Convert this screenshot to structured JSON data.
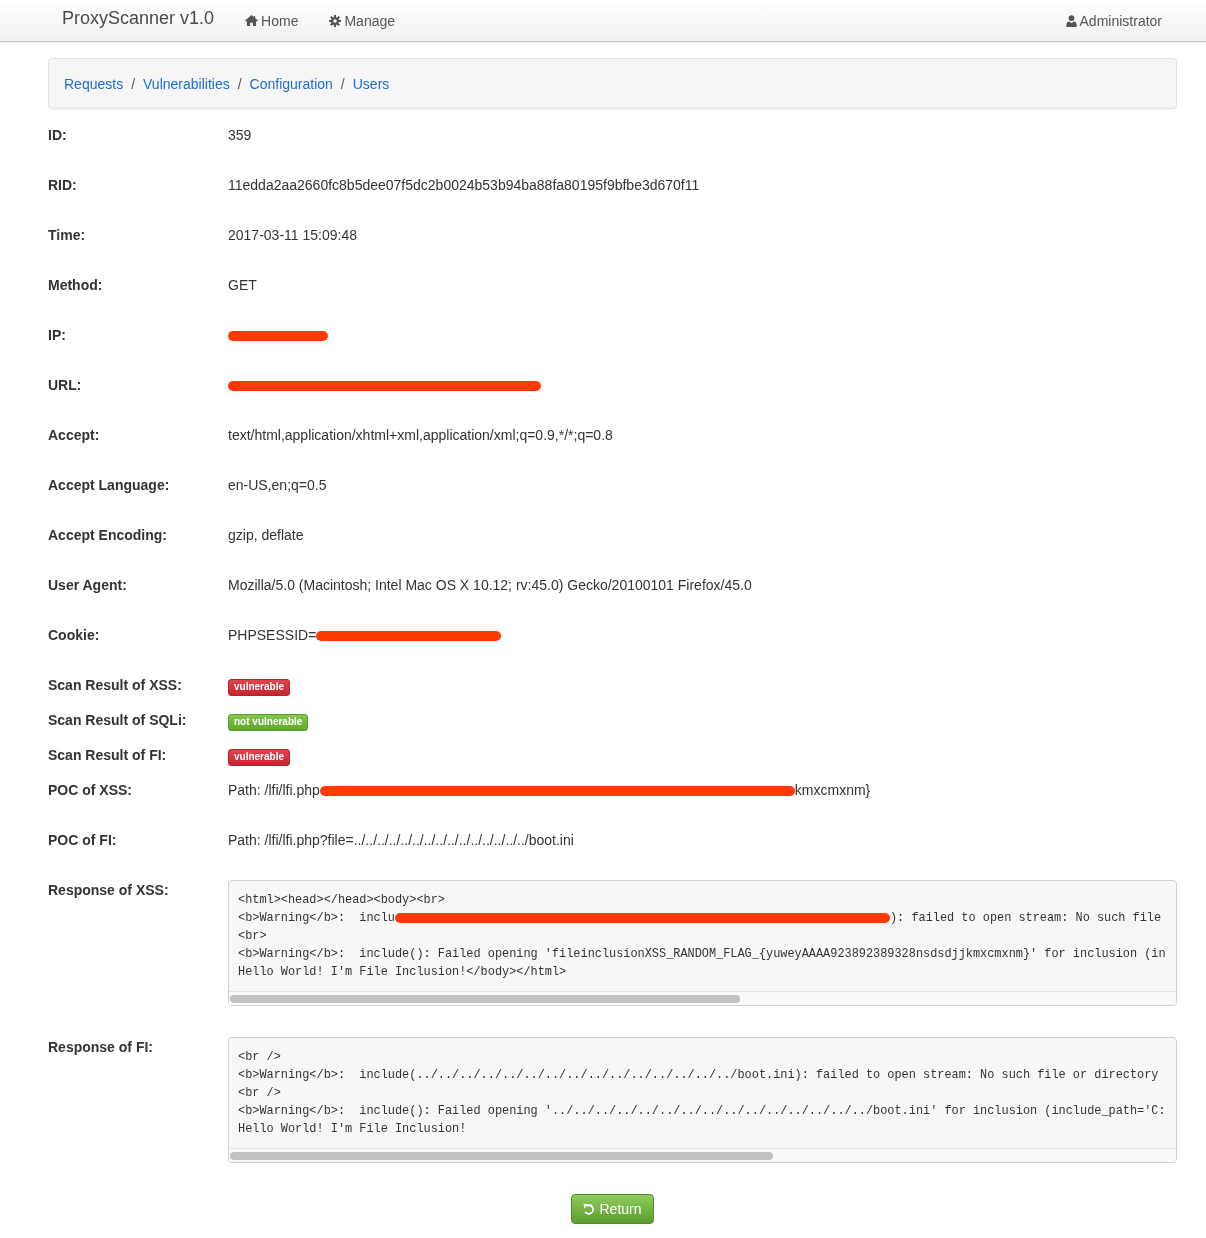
{
  "navbar": {
    "brand": "ProxyScanner v1.0",
    "links": [
      {
        "label": "Home"
      },
      {
        "label": "Manage"
      }
    ],
    "user": "Administrator"
  },
  "breadcrumb": [
    {
      "kind": "link",
      "label": "Requests"
    },
    {
      "kind": "separator",
      "label": "/"
    },
    {
      "kind": "link",
      "label": "Vulnerabilities"
    },
    {
      "kind": "separator",
      "label": "/"
    },
    {
      "kind": "link",
      "label": "Configuration"
    },
    {
      "kind": "separator",
      "label": "/"
    },
    {
      "kind": "link",
      "label": "Users"
    }
  ],
  "details": [
    {
      "label": "ID:",
      "kind": "text",
      "value": [
        {
          "kind": "text",
          "text": "359"
        }
      ]
    },
    {
      "label": "RID:",
      "kind": "text",
      "value": [
        {
          "kind": "text",
          "text": "11edda2aa2660fc8b5dee07f5dc2b0024b53b94ba88fa80195f9bfbe3d670f11"
        }
      ]
    },
    {
      "label": "Time:",
      "kind": "text",
      "value": [
        {
          "kind": "text",
          "text": "2017-03-11 15:09:48"
        }
      ]
    },
    {
      "label": "Method:",
      "kind": "text",
      "value": [
        {
          "kind": "text",
          "text": "GET"
        }
      ]
    },
    {
      "label": "IP:",
      "kind": "text",
      "value": [
        {
          "kind": "redacted"
        }
      ]
    },
    {
      "label": "URL:",
      "kind": "text",
      "value": [
        {
          "kind": "redacted"
        }
      ]
    },
    {
      "label": "Accept:",
      "kind": "text",
      "value": [
        {
          "kind": "text",
          "text": "text/html,application/xhtml+xml,application/xml;q=0.9,*/*;q=0.8"
        }
      ]
    },
    {
      "label": "Accept Language:",
      "kind": "text",
      "value": [
        {
          "kind": "text",
          "text": "en-US,en;q=0.5"
        }
      ]
    },
    {
      "label": "Accept Encoding:",
      "kind": "text",
      "value": [
        {
          "kind": "text",
          "text": "gzip, deflate"
        }
      ]
    },
    {
      "label": "User Agent:",
      "kind": "text",
      "value": [
        {
          "kind": "text",
          "text": "Mozilla/5.0 (Macintosh; Intel Mac OS X 10.12; rv:45.0) Gecko/20100101 Firefox/45.0"
        }
      ]
    },
    {
      "label": "Cookie:",
      "kind": "text",
      "value": [
        {
          "kind": "text",
          "text": "PHPSESSID="
        },
        {
          "kind": "redacted"
        }
      ]
    },
    {
      "label": "Scan Result of XSS:",
      "kind": "badge",
      "badge": {
        "label": "vulnerable",
        "vulnerable": true
      }
    },
    {
      "label": "Scan Result of SQLi:",
      "kind": "badge",
      "badge": {
        "label": "not vulnerable",
        "vulnerable": false
      }
    },
    {
      "label": "Scan Result of FI:",
      "kind": "badge",
      "badge": {
        "label": "vulnerable",
        "vulnerable": true
      }
    },
    {
      "label": "POC of XSS:",
      "kind": "text",
      "value": [
        {
          "kind": "text",
          "text": "Path: /lfi/lfi.php"
        },
        {
          "kind": "redacted"
        },
        {
          "kind": "text",
          "text": "kmxcmxnm}"
        }
      ]
    },
    {
      "label": "POC of FI:",
      "kind": "text",
      "value": [
        {
          "kind": "text",
          "text": "Path: /lfi/lfi.php?file=../../../../../../../../../../../../../../../boot.ini"
        }
      ]
    },
    {
      "label": "Response of XSS:",
      "kind": "code",
      "lines": [
        [
          {
            "kind": "text",
            "text": "<html><head></head><body><br>"
          }
        ],
        [
          {
            "kind": "text",
            "text": "<b>Warning</b>:  inclu"
          },
          {
            "kind": "redacted"
          },
          {
            "kind": "text",
            "text": "): failed to open stream: No such file"
          }
        ],
        [
          {
            "kind": "text",
            "text": "<br>"
          }
        ],
        [
          {
            "kind": "text",
            "text": "<b>Warning</b>:  include(): Failed opening 'fileinclusionXSS_RANDOM_FLAG_{yuweyAAAA923892389328nsdsdjjkmxcmxnm}' for inclusion (in"
          }
        ],
        [
          {
            "kind": "text",
            "text": "Hello World! I'm File Inclusion!</body></html>"
          }
        ]
      ]
    },
    {
      "label": "Response of FI:",
      "kind": "code",
      "lines": [
        [
          {
            "kind": "text",
            "text": "<br />"
          }
        ],
        [
          {
            "kind": "text",
            "text": "<b>Warning</b>:  include(../../../../../../../../../../../../../../../boot.ini): failed to open stream: No such file or directory"
          }
        ],
        [
          {
            "kind": "text",
            "text": "<br />"
          }
        ],
        [
          {
            "kind": "text",
            "text": "<b>Warning</b>:  include(): Failed opening '../../../../../../../../../../../../../../../boot.ini' for inclusion (include_path='C:"
          }
        ],
        [
          {
            "kind": "text",
            "text": "Hello World! I'm File Inclusion!"
          }
        ]
      ]
    }
  ],
  "return_button": {
    "label": "Return"
  }
}
